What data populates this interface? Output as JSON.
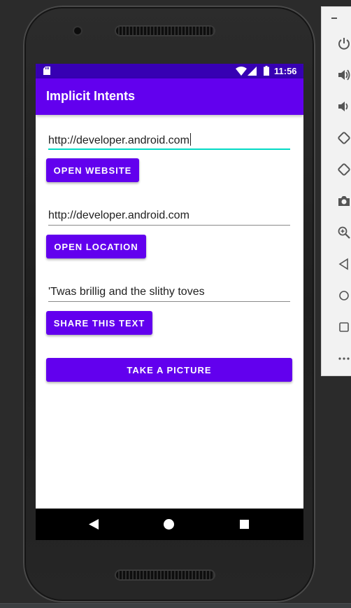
{
  "status_bar": {
    "time": "11:56"
  },
  "app_bar": {
    "title": "Implicit Intents"
  },
  "website": {
    "input_value": "http://developer.android.com",
    "button_label": "OPEN WEBSITE"
  },
  "location": {
    "input_value": "http://developer.android.com",
    "button_label": "OPEN LOCATION"
  },
  "share": {
    "input_value": "'Twas brillig and the slithy toves",
    "button_label": "SHARE THIS TEXT"
  },
  "camera": {
    "button_label": "TAKE A PICTURE"
  },
  "colors": {
    "status_bar": "#3700b3",
    "app_bar": "#6200ee",
    "button": "#6200ee",
    "focus_underline": "#03dac5"
  },
  "emulator_toolbar": {
    "icons": [
      "minimize-icon",
      "power-icon",
      "volume-up-icon",
      "volume-down-icon",
      "rotate-left-icon",
      "rotate-right-icon",
      "camera-icon",
      "zoom-icon",
      "back-icon",
      "home-icon",
      "overview-icon",
      "more-icon"
    ]
  }
}
